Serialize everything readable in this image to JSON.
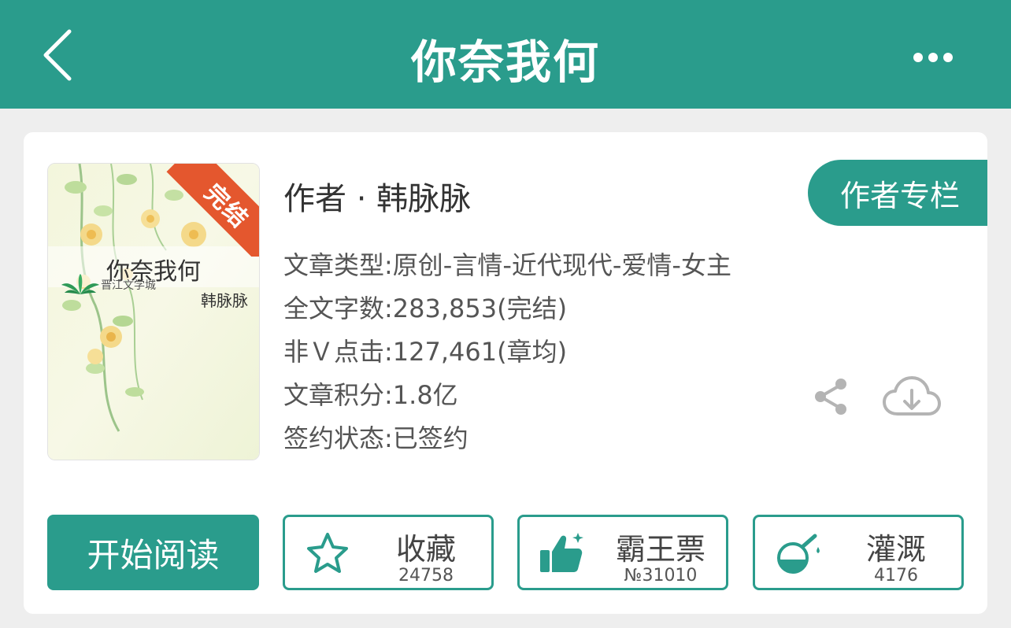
{
  "header": {
    "title": "你奈我何",
    "back_icon": "chevron-left-icon",
    "more_icon": "more-horizontal-icon"
  },
  "book": {
    "cover": {
      "title": "你奈我何",
      "author": "韩脉脉",
      "badge": "完结",
      "publisher_logo_text": "晋江文学城"
    },
    "author_line": "作者 · 韩脉脉",
    "author_column_label": "作者专栏",
    "meta": [
      "文章类型:原创-言情-近代现代-爱情-女主",
      "全文字数:283,853(完结)",
      "非Ｖ点击:127,461(章均)",
      "文章积分:1.8亿",
      "签约状态:已签约"
    ]
  },
  "actions": {
    "read_label": "开始阅读",
    "favorite": {
      "label": "收藏",
      "count": "24758",
      "icon": "star-icon"
    },
    "vote": {
      "label": "霸王票",
      "count": "№31010",
      "icon": "thumbs-up-icon"
    },
    "water": {
      "label": "灌溉",
      "count": "4176",
      "icon": "watering-flask-icon"
    },
    "share_icon": "share-icon",
    "download_icon": "cloud-download-icon"
  },
  "colors": {
    "accent": "#2a9c8c",
    "badge": "#e4572e",
    "background": "#eeeeee"
  }
}
